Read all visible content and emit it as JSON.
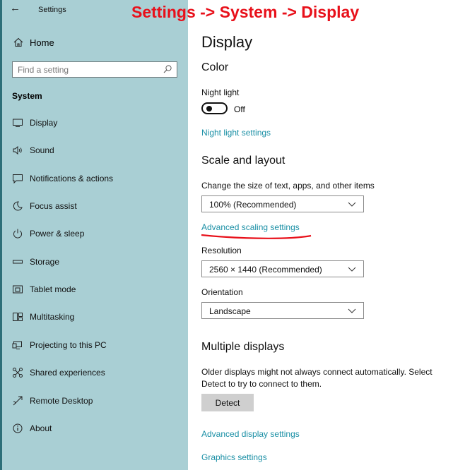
{
  "window": {
    "title": "Settings"
  },
  "annotation": "Settings -> System -> Display",
  "sidebar": {
    "home_label": "Home",
    "search_placeholder": "Find a setting",
    "section": "System",
    "items": [
      {
        "label": "Display",
        "icon": "monitor-icon"
      },
      {
        "label": "Sound",
        "icon": "speaker-icon"
      },
      {
        "label": "Notifications & actions",
        "icon": "message-icon"
      },
      {
        "label": "Focus assist",
        "icon": "moon-icon"
      },
      {
        "label": "Power & sleep",
        "icon": "power-icon"
      },
      {
        "label": "Storage",
        "icon": "drive-icon"
      },
      {
        "label": "Tablet mode",
        "icon": "tablet-icon"
      },
      {
        "label": "Multitasking",
        "icon": "multitask-icon"
      },
      {
        "label": "Projecting to this PC",
        "icon": "projector-icon"
      },
      {
        "label": "Shared experiences",
        "icon": "share-icon"
      },
      {
        "label": "Remote Desktop",
        "icon": "remote-icon"
      },
      {
        "label": "About",
        "icon": "info-icon"
      }
    ]
  },
  "main": {
    "title": "Display",
    "color_heading": "Color",
    "night_light_label": "Night light",
    "night_light_state": "Off",
    "night_light_settings": "Night light settings",
    "scale_heading": "Scale and layout",
    "scale_desc": "Change the size of text, apps, and other items",
    "scale_value": "100% (Recommended)",
    "advanced_scaling": "Advanced scaling settings",
    "resolution_label": "Resolution",
    "resolution_value": "2560 × 1440 (Recommended)",
    "orientation_label": "Orientation",
    "orientation_value": "Landscape",
    "multiple_heading": "Multiple displays",
    "multiple_desc": "Older displays might not always connect automatically. Select Detect to try to connect to them.",
    "detect_label": "Detect",
    "advanced_display": "Advanced display settings",
    "graphics_settings": "Graphics settings"
  },
  "colors": {
    "sidebar": "#a9cfd4",
    "link": "#1a8fa5",
    "annotation": "#e8101a"
  }
}
